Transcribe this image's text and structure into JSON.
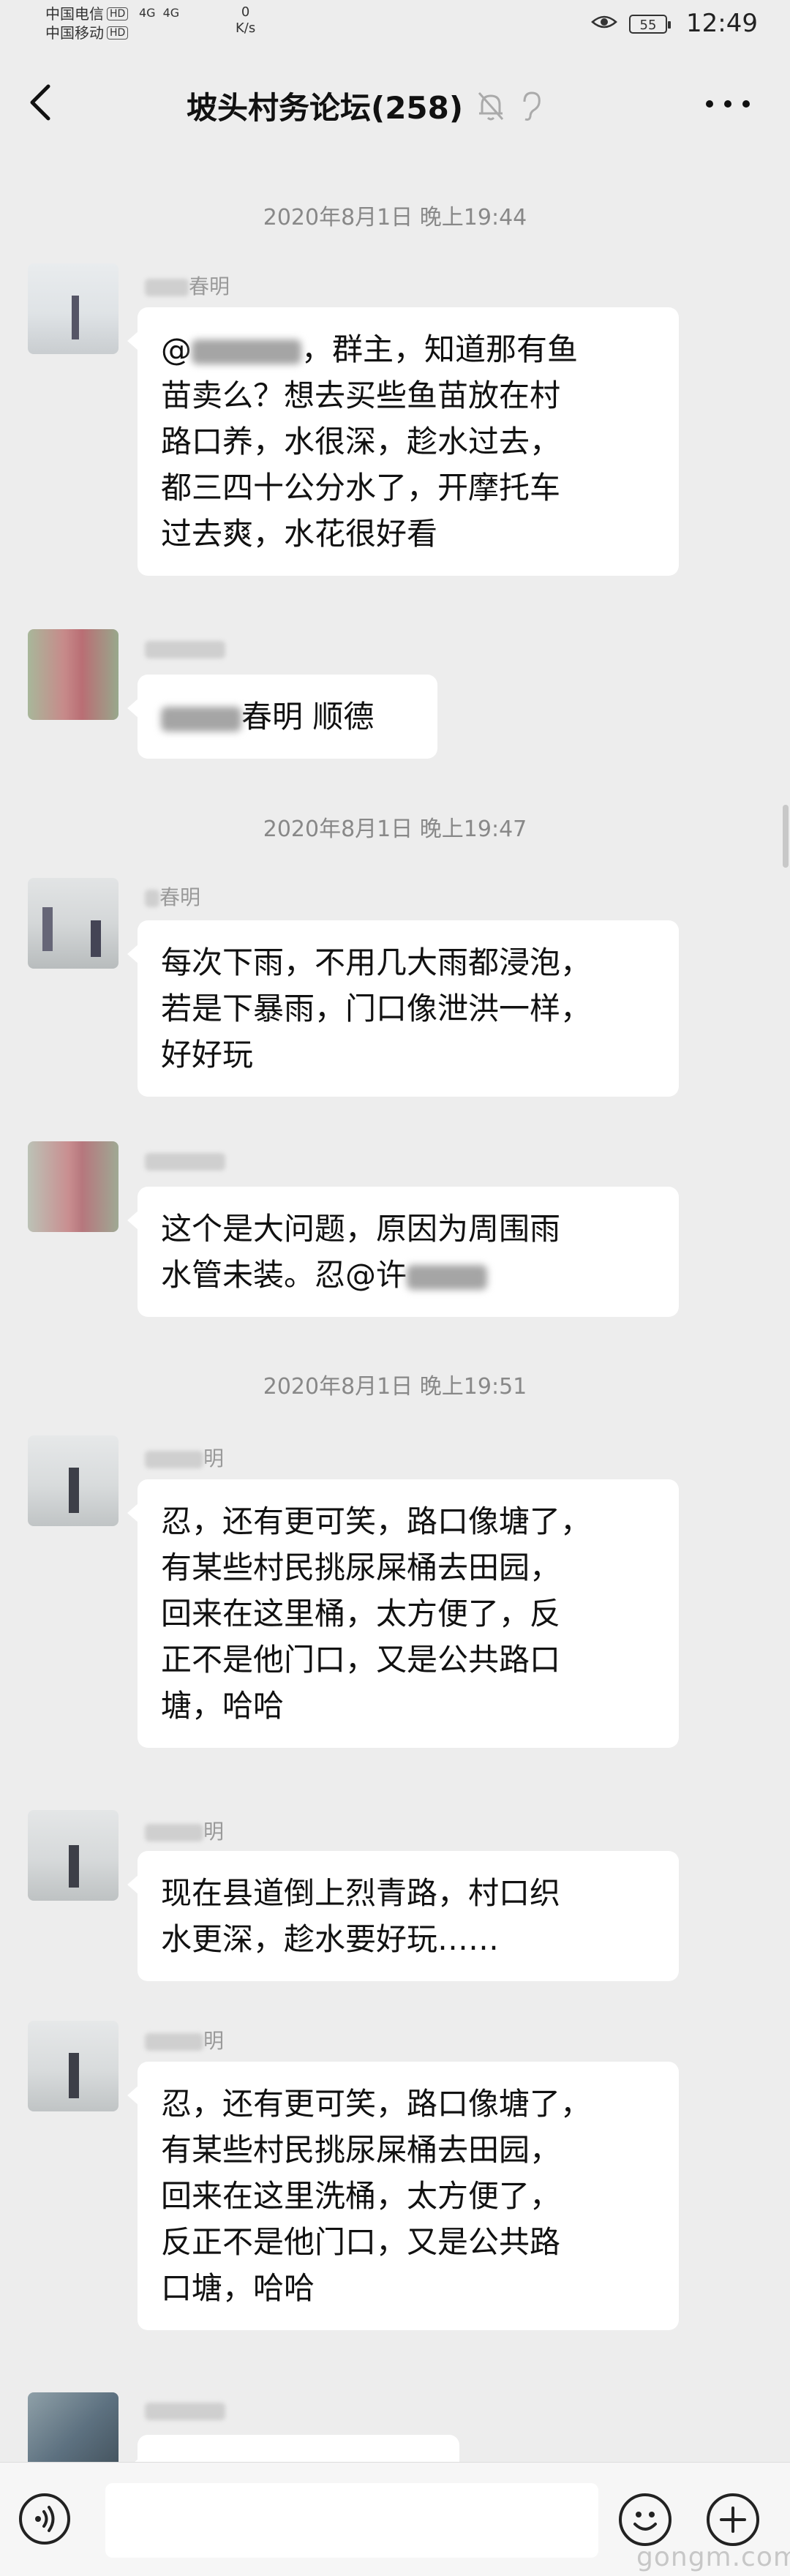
{
  "status_bar": {
    "carrier1": "中国电信",
    "carrier2": "中国移动",
    "hd": "HD",
    "net1": "4G",
    "net2": "4G",
    "speed_value": "0",
    "speed_unit": "K/s",
    "battery": "55",
    "time": "12:49"
  },
  "header": {
    "title": "坡头村务论坛(258)",
    "icons": [
      "back-icon",
      "mute-bell-icon",
      "ear-icon",
      "more-icon"
    ]
  },
  "messages": [
    {
      "type": "time",
      "text": "2020年8月1日 晚上19:44"
    },
    {
      "type": "msg",
      "sender_suffix": "春明",
      "lines": [
        "@[blur]，群主，知道那有鱼",
        "苗卖么？想去买些鱼苗放在村",
        "路口养，水很深，趁水过去，",
        "都三四十公分水了，开摩托车",
        "过去爽，水花很好看"
      ]
    },
    {
      "type": "msg",
      "sender_suffix": "",
      "lines": [
        "[blur]春明  顺德"
      ]
    },
    {
      "type": "time",
      "text": "2020年8月1日 晚上19:47"
    },
    {
      "type": "msg",
      "sender_suffix": "春明",
      "lines": [
        "每次下雨，不用几大雨都浸泡，",
        "若是下暴雨，门口像泄洪一样，",
        "好好玩"
      ]
    },
    {
      "type": "msg",
      "sender_suffix": "",
      "lines": [
        "这个是大问题，原因为周围雨",
        "水管未装。忍@许[blur]"
      ]
    },
    {
      "type": "time",
      "text": "2020年8月1日 晚上19:51"
    },
    {
      "type": "msg",
      "sender_suffix": "明",
      "lines": [
        "忍，还有更可笑，路口像塘了，",
        "有某些村民挑尿屎桶去田园，",
        "回来在这里桶，太方便了，反",
        "正不是他门口，又是公共路口",
        "塘，哈哈"
      ]
    },
    {
      "type": "msg",
      "sender_suffix": "明",
      "lines": [
        "现在县道倒上烈青路，村口织",
        "水更深，趁水要好玩……"
      ]
    },
    {
      "type": "msg",
      "sender_suffix": "明",
      "lines": [
        "忍，还有更可笑，路口像塘了，",
        "有某些村民挑尿屎桶去田园，",
        "回来在这里洗桶，太方便了，",
        "反正不是他门口，又是公共路",
        "口塘，哈哈"
      ]
    }
  ],
  "render": {
    "time1": "2020年8月1日 晚上19:44",
    "time2": "2020年8月1日 晚上19:47",
    "time3": "2020年8月1日 晚上19:51",
    "m1_sender": "春明",
    "m1_l1a": "@",
    "m1_l1b": "，群主，知道那有鱼",
    "m1_l2": "苗卖么？想去买些鱼苗放在村",
    "m1_l3": "路口养，水很深，趁水过去，",
    "m1_l4": "都三四十公分水了，开摩托车",
    "m1_l5": "过去爽，水花很好看",
    "m2_text": "春明  顺德",
    "m3_sender": "春明",
    "m3_l1": "每次下雨，不用几大雨都浸泡，",
    "m3_l2": "若是下暴雨，门口像泄洪一样，",
    "m3_l3": "好好玩",
    "m4_l1": "这个是大问题，原因为周围雨",
    "m4_l2": "水管未装。忍@许",
    "m5_sender": "明",
    "m5_l1": "忍，还有更可笑，路口像塘了，",
    "m5_l2": "有某些村民挑尿屎桶去田园，",
    "m5_l3": "回来在这里桶，太方便了，反",
    "m5_l4": "正不是他门口，又是公共路口",
    "m5_l5": "塘，哈哈",
    "m6_sender": "明",
    "m6_l1": "现在县道倒上烈青路，村口织",
    "m6_l2": "水更深，趁水要好玩……",
    "m7_sender": "明",
    "m7_l1": "忍，还有更可笑，路口像塘了，",
    "m7_l2": "有某些村民挑尿屎桶去田园，",
    "m7_l3": "回来在这里洗桶，太方便了，",
    "m7_l4": "反正不是他门口，又是公共路",
    "m7_l5": "口塘，哈哈"
  },
  "input_bar": {
    "placeholder": "",
    "icons": [
      "voice-icon",
      "emoji-icon",
      "plus-icon"
    ]
  },
  "watermark": "gongm.com"
}
